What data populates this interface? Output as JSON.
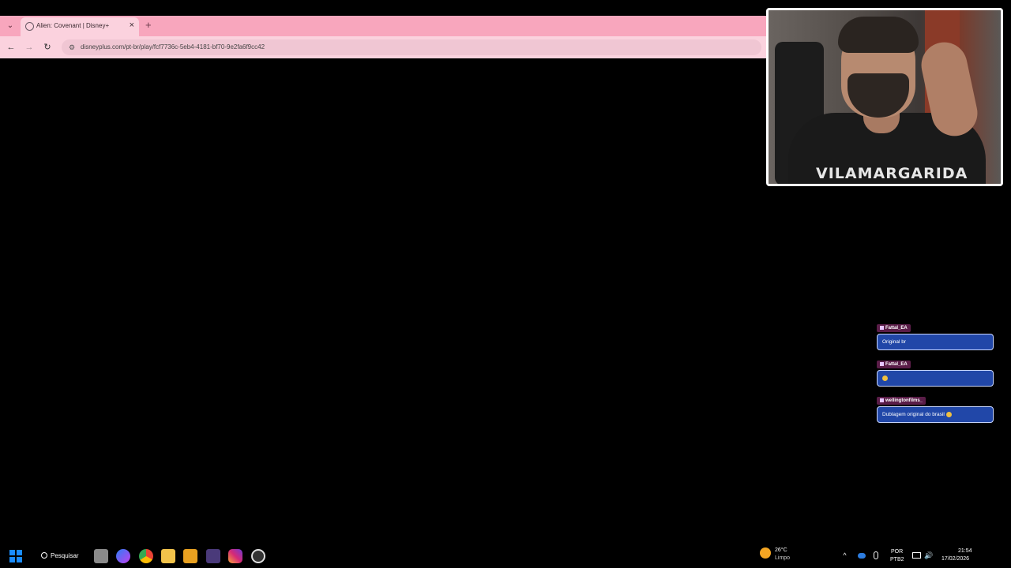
{
  "browser": {
    "tab_title": "Alien: Covenant | Disney+",
    "tab_close_icon": "×",
    "new_tab_icon": "+",
    "tab_menu_icon": "⌄",
    "url": "disneyplus.com/pt-br/play/fcf7736c-5eb4-4181-bf70-9e2fa6f9cc42",
    "back_icon": "←",
    "forward_icon": "→",
    "reload_icon": "↻",
    "site_info_icon": "⚙",
    "chrome_color": "#f8a6bd"
  },
  "webcam": {
    "shirt_text": "VILAMARGARIDA"
  },
  "chat": {
    "messages": [
      {
        "user": "Fattal_EA",
        "text": "Original br"
      },
      {
        "user": "Fattal_EA",
        "text": ""
      },
      {
        "user": "wellingtonfilms_",
        "text": "Dublagem original do brasil"
      }
    ],
    "bubble_color": "#2147a8"
  },
  "taskbar": {
    "search_label": "Pesquisar",
    "weather_temp": "26°C",
    "weather_condition": "Limpo",
    "lang_primary": "POR",
    "lang_secondary": "PTB2",
    "time": "21:54",
    "date": "17/02/2026",
    "tray_chevron_icon": "^",
    "tray_volume_icon": "🔊"
  }
}
